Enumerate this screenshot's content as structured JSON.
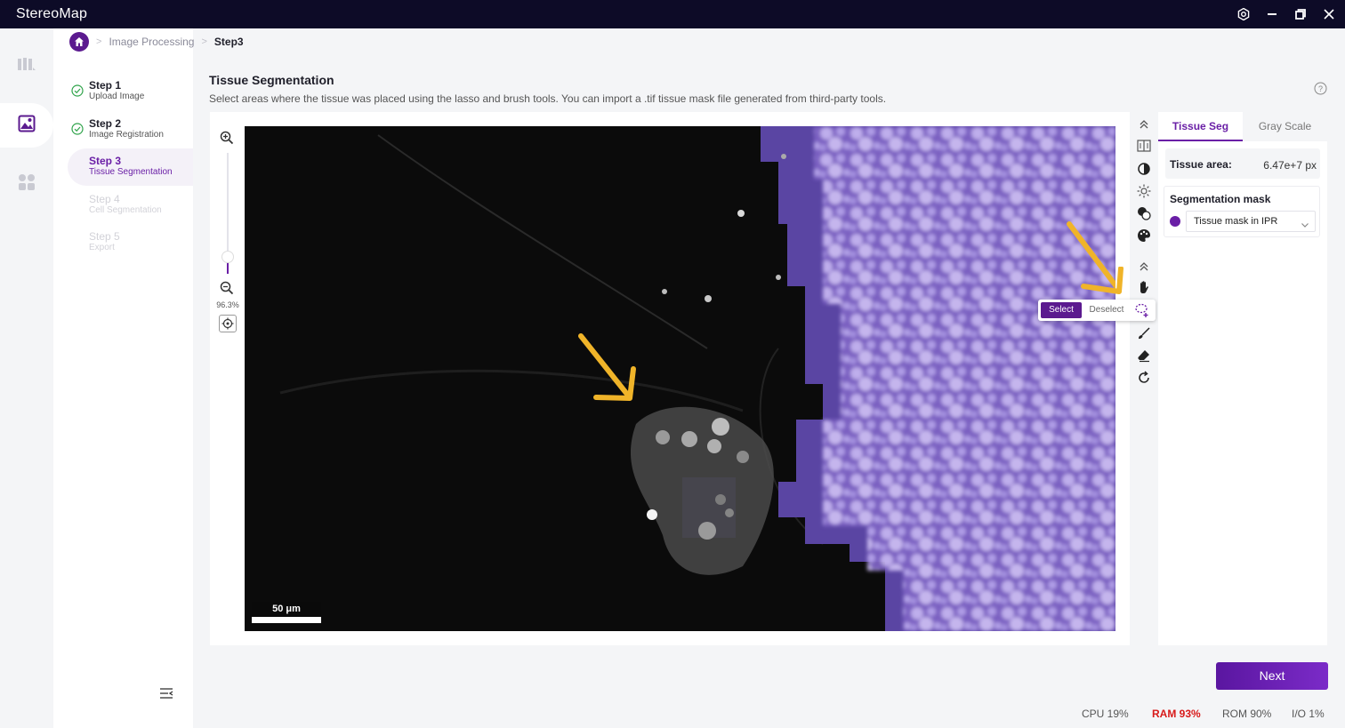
{
  "app": {
    "title": "StereoMap"
  },
  "breadcrumb": {
    "section": "Image Processing",
    "current": "Step3"
  },
  "steps": [
    {
      "title": "Step 1",
      "subtitle": "Upload Image",
      "state": "done"
    },
    {
      "title": "Step 2",
      "subtitle": "Image Registration",
      "state": "done"
    },
    {
      "title": "Step 3",
      "subtitle": "Tissue Segmentation",
      "state": "active"
    },
    {
      "title": "Step 4",
      "subtitle": "Cell Segmentation",
      "state": "disabled"
    },
    {
      "title": "Step 5",
      "subtitle": "Export",
      "state": "disabled"
    }
  ],
  "main": {
    "title": "Tissue Segmentation",
    "description": "Select areas where the tissue was placed using the lasso and brush tools. You can import a .tif tissue mask file generated from third-party tools."
  },
  "viewer": {
    "zoom_label": "96.3%",
    "scale_label": "50 μm"
  },
  "popover": {
    "select_label": "Select",
    "deselect_label": "Deselect"
  },
  "right_panel": {
    "tabs": [
      "Tissue Seg",
      "Gray Scale"
    ],
    "tissue_area_label": "Tissue area:",
    "tissue_area_value": "6.47e+7 px",
    "mask_title": "Segmentation mask",
    "mask_value": "Tissue mask in IPR"
  },
  "footer": {
    "next_label": "Next",
    "cpu": "CPU  19%",
    "ram": "RAM  93%",
    "rom": "ROM  90%",
    "io": "I/O  1%"
  },
  "colors": {
    "accent": "#6a1fa6",
    "titlebar": "#0d0b27",
    "mask": "#8a6fd0",
    "annotation_arrow": "#f0b429"
  },
  "icons": [
    "settings-icon",
    "minimize-icon",
    "restore-icon",
    "close-icon",
    "map-icon",
    "image-icon",
    "apps-icon",
    "home-icon",
    "zoom-in-icon",
    "zoom-out-icon",
    "fit-view-icon",
    "collapse-up-icon",
    "split-view-icon",
    "contrast-icon",
    "brightness-icon",
    "overlay-icon",
    "palette-icon",
    "hand-icon",
    "lasso-add-icon",
    "brush-icon",
    "eraser-icon",
    "redo-icon",
    "help-icon",
    "chevron-down-icon",
    "menu-collapse-icon"
  ]
}
